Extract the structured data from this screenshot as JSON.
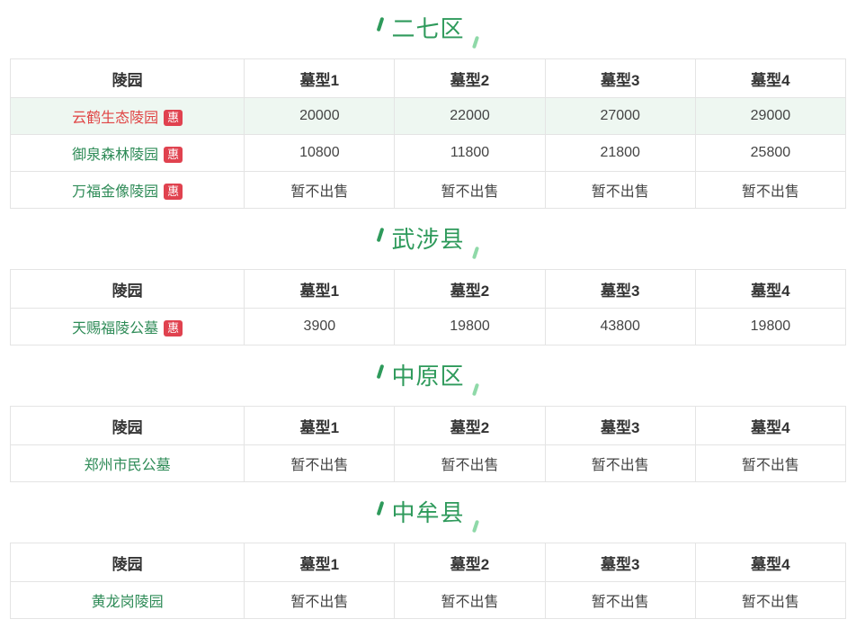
{
  "headers": [
    "陵园",
    "墓型1",
    "墓型2",
    "墓型3",
    "墓型4"
  ],
  "badge": "惠",
  "sections": [
    {
      "title": "二七区",
      "rows": [
        {
          "name": "云鹤生态陵园",
          "badge": true,
          "vals": [
            "20000",
            "22000",
            "27000",
            "29000"
          ]
        },
        {
          "name": "御泉森林陵园",
          "badge": true,
          "vals": [
            "10800",
            "11800",
            "21800",
            "25800"
          ]
        },
        {
          "name": "万福金像陵园",
          "badge": true,
          "vals": [
            "暂不出售",
            "暂不出售",
            "暂不出售",
            "暂不出售"
          ]
        }
      ]
    },
    {
      "title": "武涉县",
      "rows": [
        {
          "name": "天赐福陵公墓",
          "badge": true,
          "vals": [
            "3900",
            "19800",
            "43800",
            "19800"
          ]
        }
      ]
    },
    {
      "title": "中原区",
      "rows": [
        {
          "name": "郑州市民公墓",
          "badge": false,
          "vals": [
            "暂不出售",
            "暂不出售",
            "暂不出售",
            "暂不出售"
          ]
        }
      ]
    },
    {
      "title": "中牟县",
      "rows": [
        {
          "name": "黄龙岗陵园",
          "badge": false,
          "vals": [
            "暂不出售",
            "暂不出售",
            "暂不出售",
            "暂不出售"
          ]
        }
      ]
    }
  ]
}
